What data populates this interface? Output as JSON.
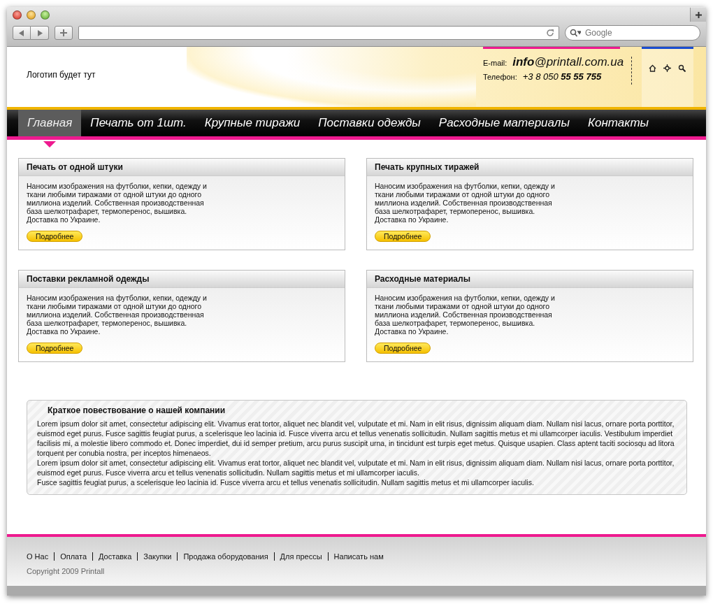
{
  "browser": {
    "search": {
      "placeholder": "Google"
    }
  },
  "header": {
    "logo": "Логотип будет тут",
    "email_label": "E-mail:",
    "email": "**info**@printall.com.ua",
    "phone_label": "Телефон:",
    "phone": "+3 8 050 **55 55 755**"
  },
  "nav": [
    {
      "label": "Главная",
      "selected": true
    },
    {
      "label": "Печать от 1шт.",
      "selected": false
    },
    {
      "label": "Крупные тиражи",
      "selected": false
    },
    {
      "label": "Поставки одежды",
      "selected": false
    },
    {
      "label": "Расходные материалы",
      "selected": false
    },
    {
      "label": "Контакты",
      "selected": false
    }
  ],
  "cards": [
    {
      "title": "Печать от одной штуки",
      "text": "Наносим изображения на футболки, кепки, одежду и ткани любыми тиражами от одной штуки до одного миллиона изделий. Собственная производственная база шелкотрафарет, термоперенос, вышивка. Доставка по Украине.",
      "button": "Подробнее"
    },
    {
      "title": "Печать крупных тиражей",
      "text": "Наносим изображения на футболки, кепки, одежду и ткани любыми тиражами от одной штуки до одного миллиона изделий. Собственная производственная база шелкотрафарет, термоперенос, вышивка. Доставка по Украине.",
      "button": "Подробнее"
    },
    {
      "title": "Поставки рекламной одежды",
      "text": "Наносим изображения на футболки, кепки, одежду и ткани любыми тиражами от одной штуки до одного миллиона изделий. Собственная производственная база шелкотрафарет, термоперенос, вышивка. Доставка по Украине.",
      "button": "Подробнее"
    },
    {
      "title": "Расходные материалы",
      "text": "Наносим изображения на футболки, кепки, одежду и ткани любыми тиражами от одной штуки до одного миллиона изделий. Собственная производственная база шелкотрафарет, термоперенос, вышивка. Доставка по Украине.",
      "button": "Подробнее"
    }
  ],
  "about": {
    "title": "Краткое повествование о нашей компании",
    "paragraphs": [
      "Lorem ipsum dolor sit amet, consectetur adipiscing elit. Vivamus erat tortor, aliquet nec blandit vel, vulputate et mi. Nam in elit risus, dignissim aliquam diam. Nullam nisi lacus, ornare porta porttitor, euismod eget purus. Fusce sagittis feugiat purus, a scelerisque leo lacinia id. Fusce viverra arcu et tellus venenatis sollicitudin. Nullam sagittis metus et mi ullamcorper iaculis. Vestibulum imperdiet facilisis mi, a molestie libero commodo et. Donec imperdiet, dui id semper pretium, arcu purus suscipit urna, in tincidunt est turpis eget metus. Quisque usapien. Class aptent taciti sociosqu ad litora torquent per conubia nostra, per inceptos himenaeos.",
      "Lorem ipsum dolor sit amet, consectetur adipiscing elit. Vivamus erat tortor, aliquet nec blandit vel, vulputate et mi. Nam in elit risus, dignissim aliquam diam. Nullam nisi lacus, ornare porta porttitor, euismod eget purus. Fusce viverra arcu et tellus venenatis sollicitudin. Nullam sagittis metus et mi ullamcorper iaculis.",
      "Fusce sagittis feugiat purus, a scelerisque leo lacinia id. Fusce viverra arcu et tellus venenatis sollicitudin. Nullam sagittis metus et mi ullamcorper iaculis."
    ]
  },
  "footer": {
    "links": [
      "О Нас",
      "Оплата",
      "Доставка",
      "Закупки",
      "Продажа оборудования",
      "Для прессы",
      "Написать нам"
    ],
    "copyright": "Copyright 2009 Printall"
  }
}
